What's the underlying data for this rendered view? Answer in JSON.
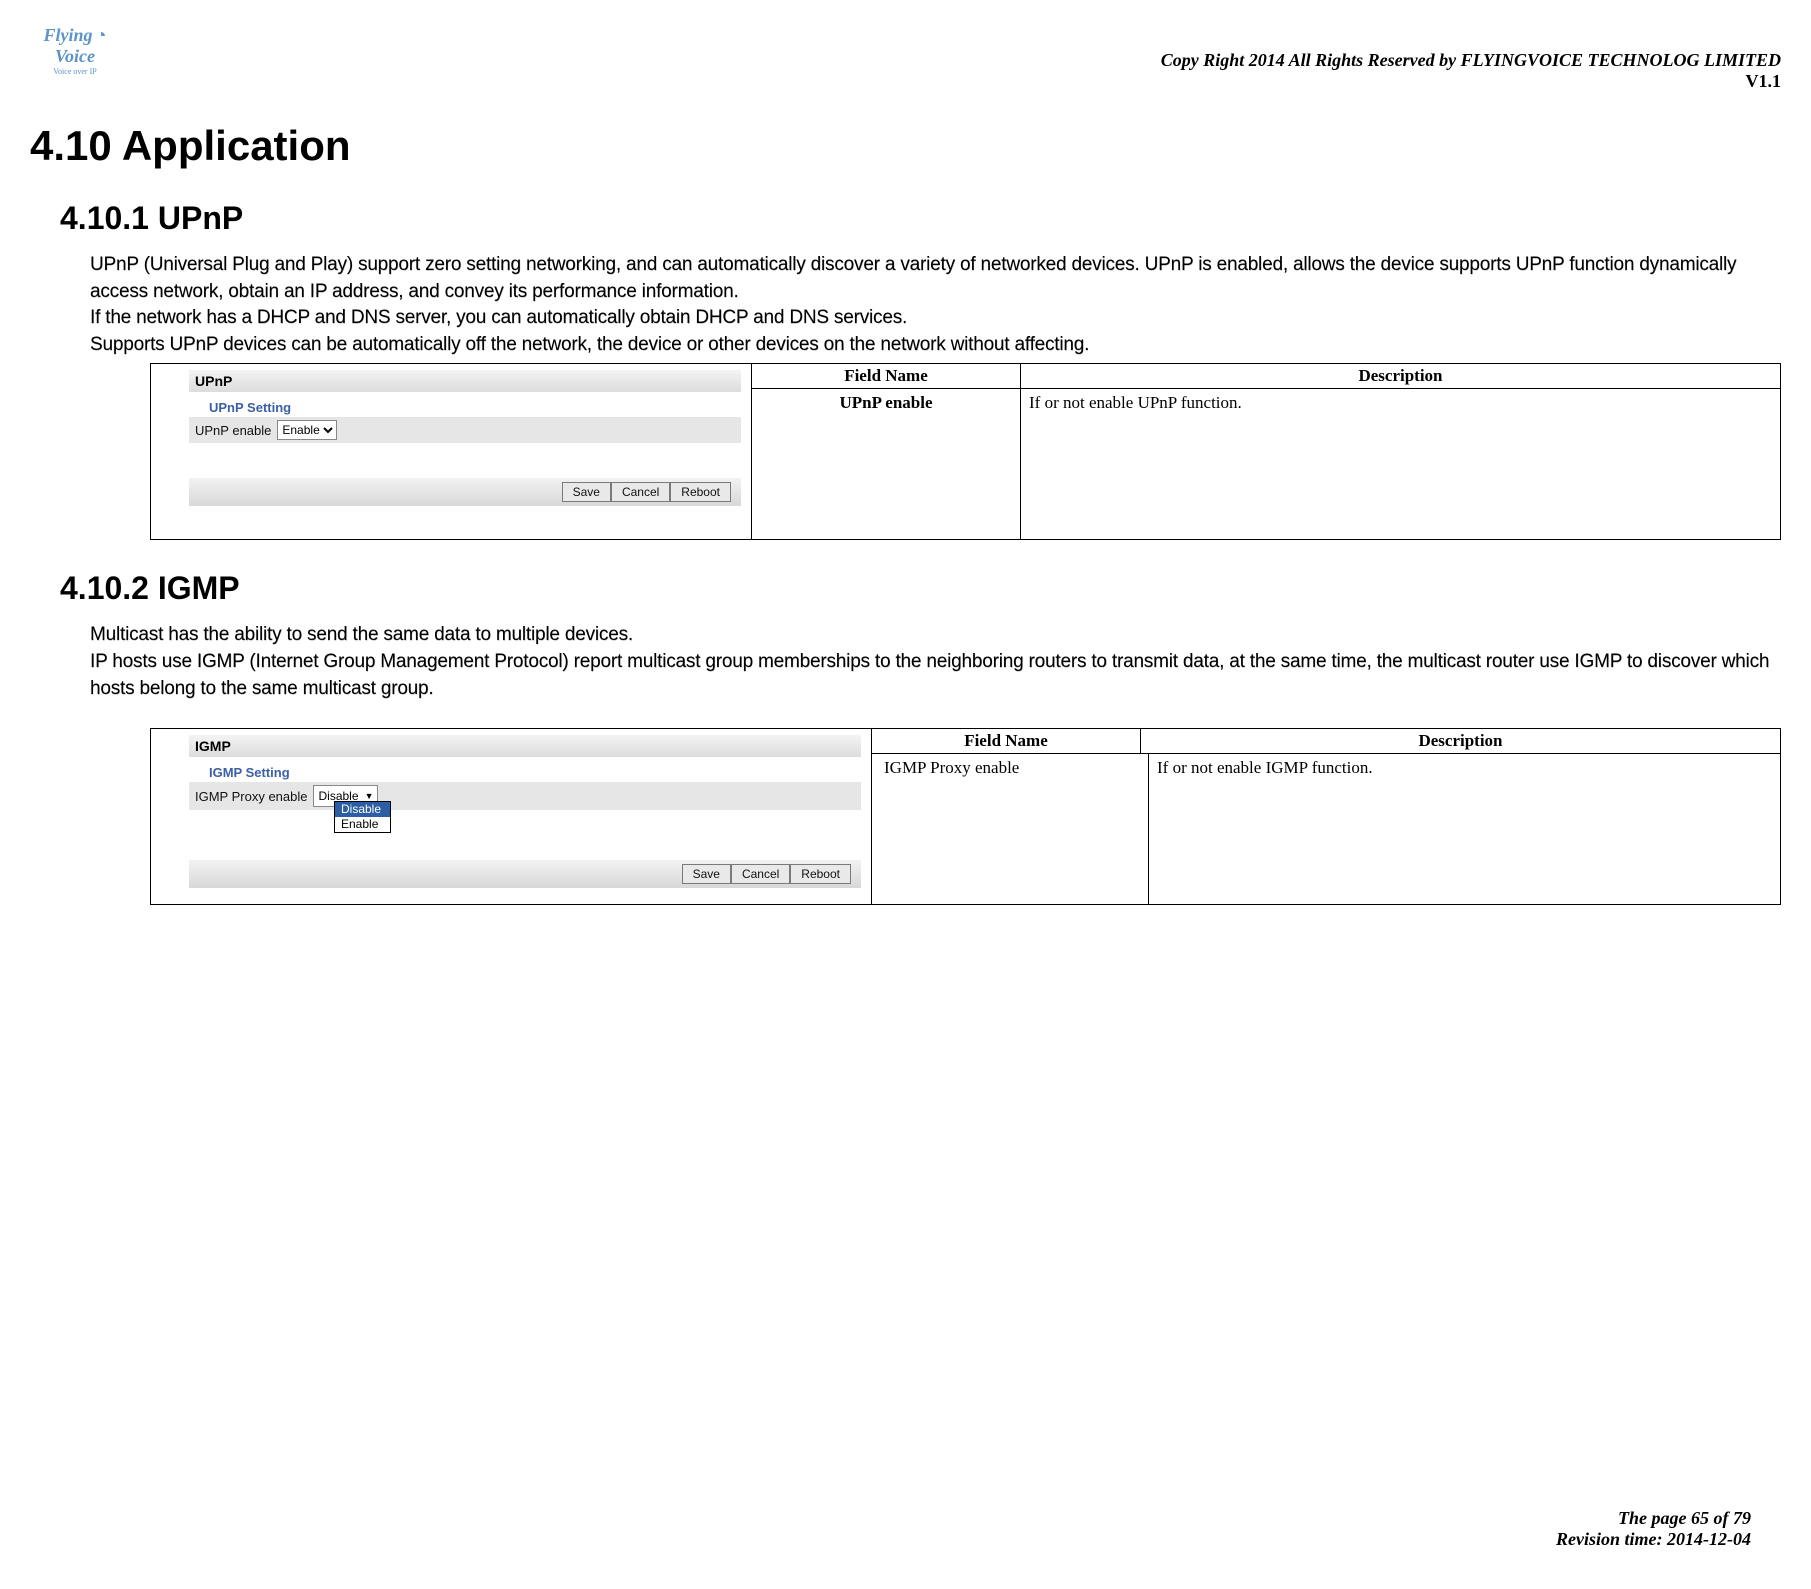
{
  "header": {
    "logo_top": "Flying",
    "logo_bottom": "Voice",
    "logo_tag": "Voice over IP",
    "copyright": "Copy Right 2014 All Rights Reserved by FLYINGVOICE TECHNOLOG LIMITED",
    "version": "V1.1"
  },
  "section": {
    "number_title": "4.10  Application"
  },
  "upnp": {
    "heading": "4.10.1  UPnP",
    "para1": "UPnP (Universal Plug and Play) support zero setting networking, and can automatically discover a variety of networked devices. UPnP is enabled, allows the device supports UPnP function dynamically access network, obtain an IP address, and convey its performance information.",
    "para2": "If the network has a DHCP and DNS server, you can automatically obtain DHCP and DNS services.",
    "para3": "Supports UPnP devices can be automatically off the network, the device or other devices on the network without affecting.",
    "pane_title": "UPnP",
    "setting_title": "UPnP Setting",
    "setting_label": "UPnP enable",
    "select_value": "Enable",
    "buttons": {
      "save": "Save",
      "cancel": "Cancel",
      "reboot": "Reboot"
    },
    "table": {
      "h1": "Field Name",
      "h2": "Description",
      "row_field": "UPnP enable",
      "row_desc": "If or not enable UPnP function."
    }
  },
  "igmp": {
    "heading": "4.10.2   IGMP",
    "para1": "Multicast has the ability to send the same data to multiple devices.",
    "para2": "IP hosts use IGMP (Internet Group Management Protocol) report multicast group memberships to the neighboring routers to transmit data, at the same time, the multicast router use IGMP to discover which hosts belong to the same multicast group.",
    "pane_title": "IGMP",
    "setting_title": "IGMP Setting",
    "setting_label": "IGMP Proxy enable",
    "select_value": "Disable",
    "dropdown_options": [
      "Disable",
      "Enable"
    ],
    "buttons": {
      "save": "Save",
      "cancel": "Cancel",
      "reboot": "Reboot"
    },
    "table": {
      "h1": "Field Name",
      "h2": "Description",
      "row_field": "IGMP Proxy enable",
      "row_desc": "If or not enable IGMP function."
    }
  },
  "footer": {
    "page": "The page 65 of 79",
    "revision": "Revision time: 2014-12-04"
  }
}
